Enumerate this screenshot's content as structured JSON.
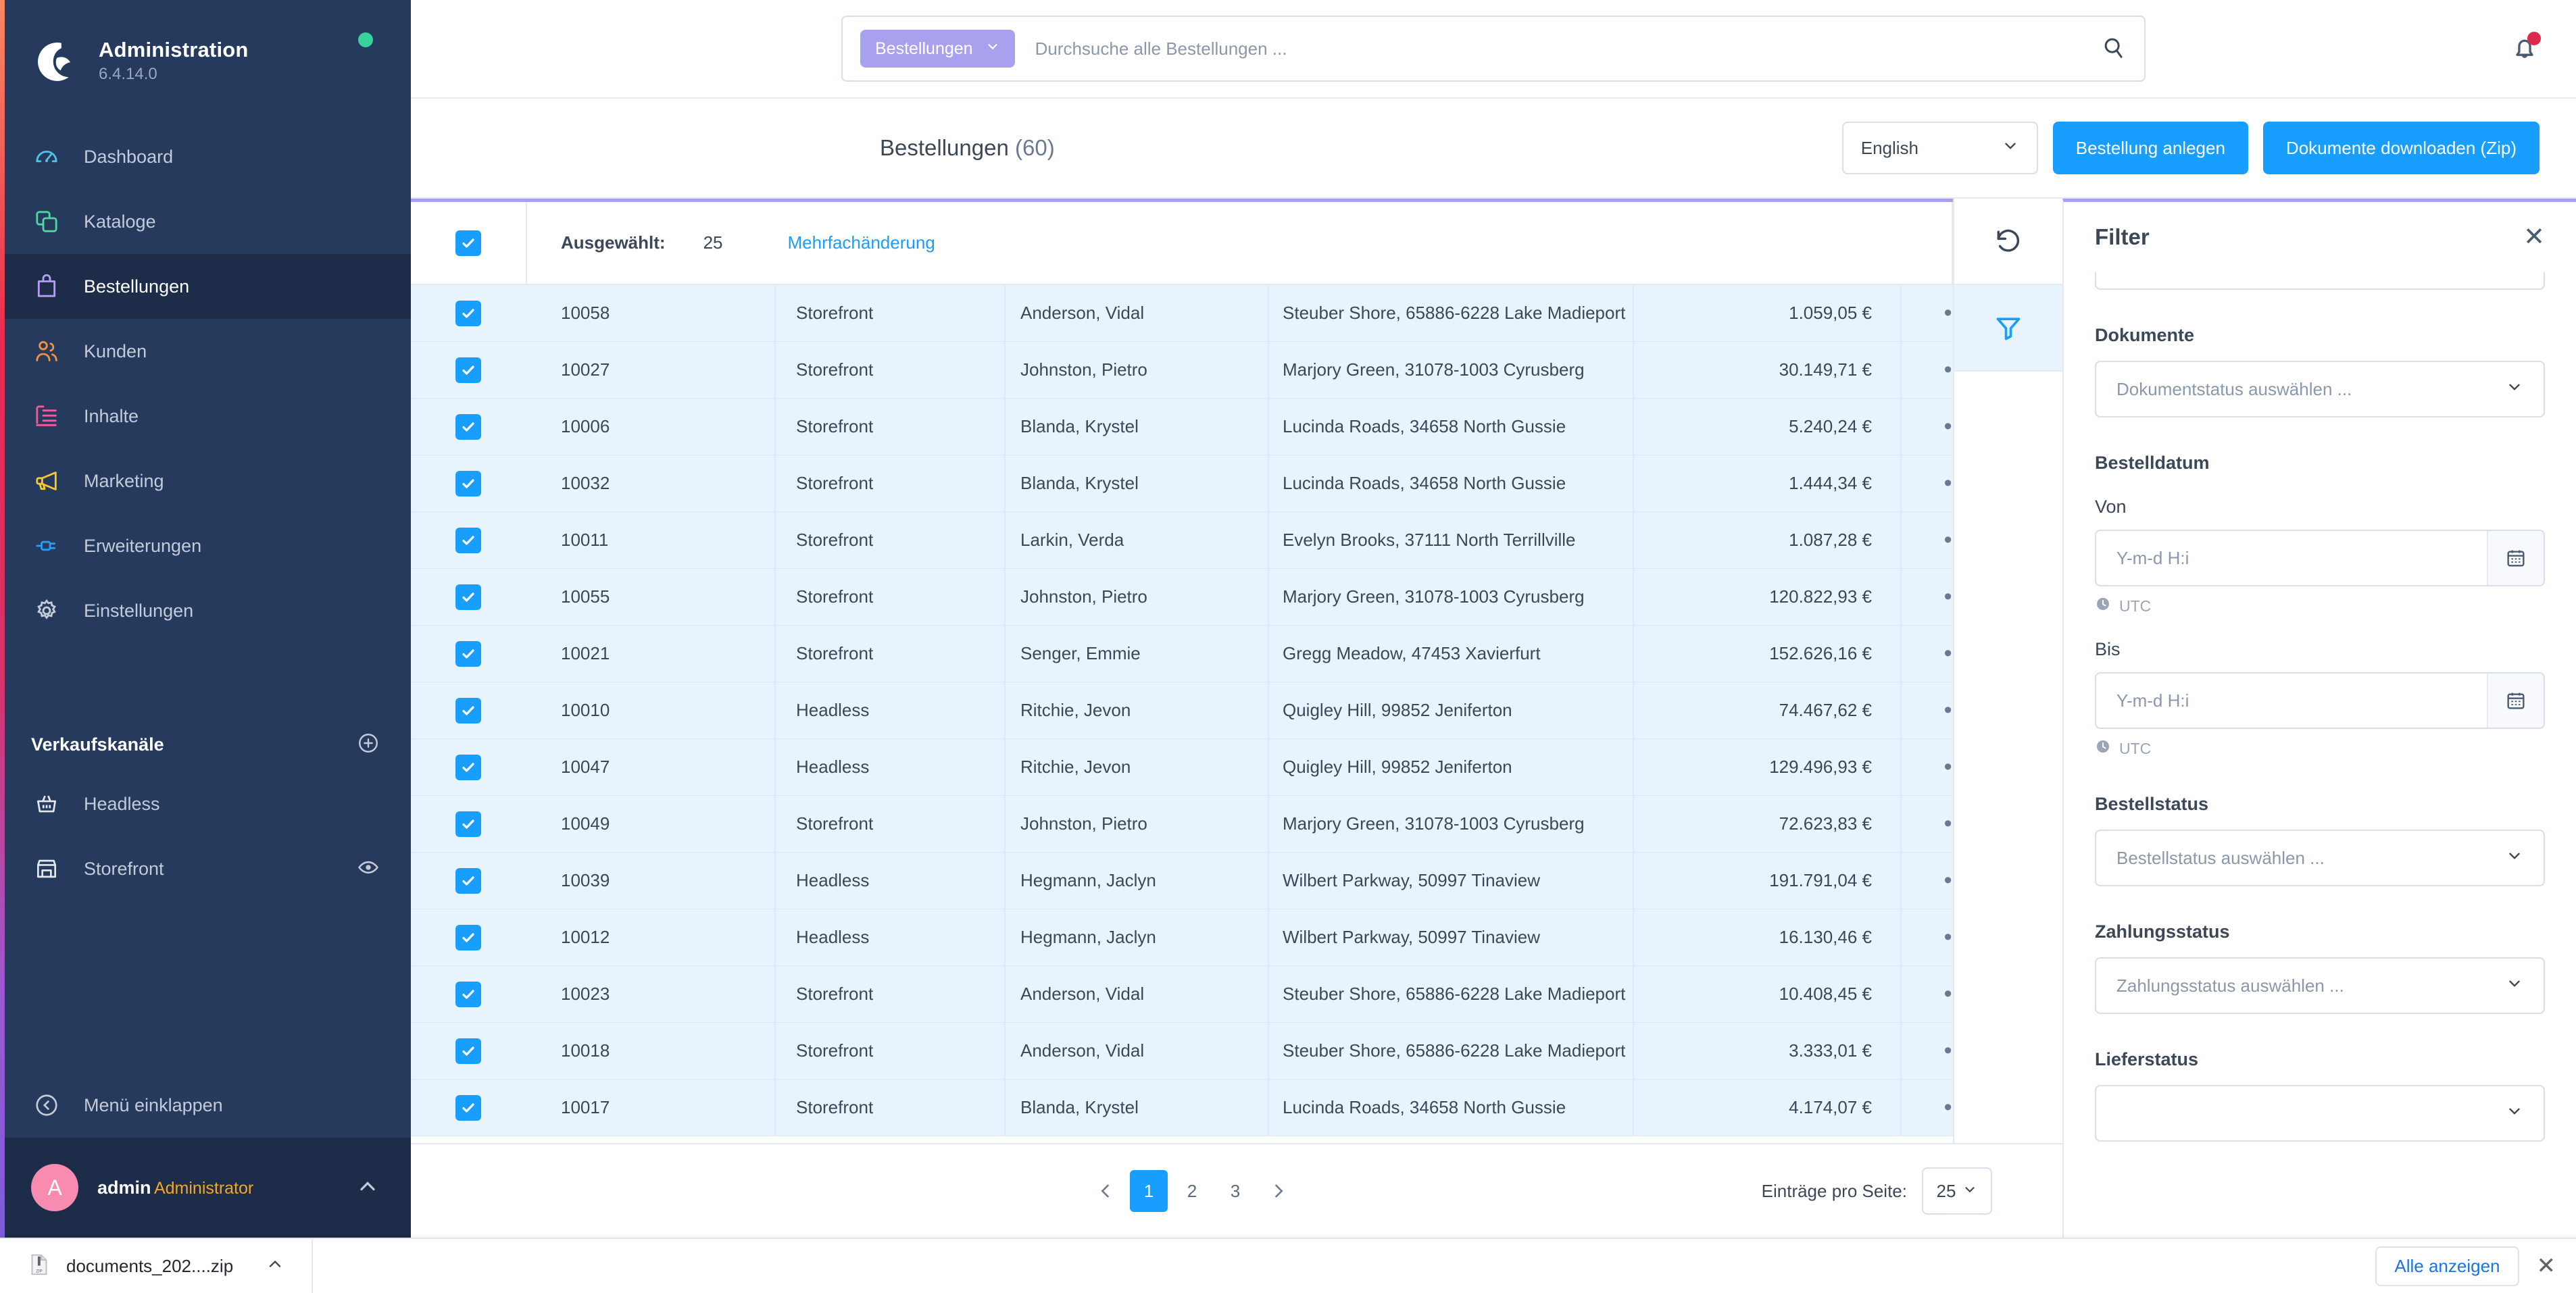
{
  "sidebar": {
    "brand": {
      "title": "Administration",
      "version": "6.4.14.0"
    },
    "items": [
      {
        "label": "Dashboard",
        "icon": "dashboard-icon",
        "color": "#4ec3e8",
        "active": false
      },
      {
        "label": "Kataloge",
        "icon": "catalog-icon",
        "color": "#4ed8a0",
        "active": false
      },
      {
        "label": "Bestellungen",
        "icon": "bag-icon",
        "color": "#b79cf5",
        "active": true
      },
      {
        "label": "Kunden",
        "icon": "users-icon",
        "color": "#f7913c",
        "active": false
      },
      {
        "label": "Inhalte",
        "icon": "content-icon",
        "color": "#f45b9b",
        "active": false
      },
      {
        "label": "Marketing",
        "icon": "megaphone-icon",
        "color": "#f7c72e",
        "active": false
      },
      {
        "label": "Erweiterungen",
        "icon": "plug-icon",
        "color": "#2b9bf4",
        "active": false
      },
      {
        "label": "Einstellungen",
        "icon": "gear-icon",
        "color": "#c3cbd9",
        "active": false
      }
    ],
    "sales_channels": {
      "title": "Verkaufskanäle",
      "items": [
        {
          "label": "Headless",
          "icon": "basket-icon",
          "has_eye": false
        },
        {
          "label": "Storefront",
          "icon": "shop-icon",
          "has_eye": true
        }
      ]
    },
    "collapse_label": "Menü einklappen",
    "user": {
      "initial": "A",
      "name": "admin",
      "role": "Administrator"
    }
  },
  "topbar": {
    "search_scope": "Bestellungen",
    "search_placeholder": "Durchsuche alle Bestellungen ...",
    "search_value": ""
  },
  "header": {
    "title": "Bestellungen",
    "count": "(60)",
    "language": "English",
    "create_order_label": "Bestellung anlegen",
    "download_docs_label": "Dokumente downloaden (Zip)"
  },
  "selection_toolbar": {
    "selected_label": "Ausgewählt:",
    "selected_count": "25",
    "bulk_edit_label": "Mehrfachänderung"
  },
  "table": {
    "rows": [
      {
        "number": "10058",
        "channel": "Storefront",
        "customer": "Anderson, Vidal",
        "address": "Steuber Shore, 65886-6228 Lake Madieport",
        "amount": "1.059,05 €"
      },
      {
        "number": "10027",
        "channel": "Storefront",
        "customer": "Johnston, Pietro",
        "address": "Marjory Green, 31078-1003 Cyrusberg",
        "amount": "30.149,71 €"
      },
      {
        "number": "10006",
        "channel": "Storefront",
        "customer": "Blanda, Krystel",
        "address": "Lucinda Roads, 34658 North Gussie",
        "amount": "5.240,24 €"
      },
      {
        "number": "10032",
        "channel": "Storefront",
        "customer": "Blanda, Krystel",
        "address": "Lucinda Roads, 34658 North Gussie",
        "amount": "1.444,34 €"
      },
      {
        "number": "10011",
        "channel": "Storefront",
        "customer": "Larkin, Verda",
        "address": "Evelyn Brooks, 37111 North Terrillville",
        "amount": "1.087,28 €"
      },
      {
        "number": "10055",
        "channel": "Storefront",
        "customer": "Johnston, Pietro",
        "address": "Marjory Green, 31078-1003 Cyrusberg",
        "amount": "120.822,93 €"
      },
      {
        "number": "10021",
        "channel": "Storefront",
        "customer": "Senger, Emmie",
        "address": "Gregg Meadow, 47453 Xavierfurt",
        "amount": "152.626,16 €"
      },
      {
        "number": "10010",
        "channel": "Headless",
        "customer": "Ritchie, Jevon",
        "address": "Quigley Hill, 99852 Jeniferton",
        "amount": "74.467,62 €"
      },
      {
        "number": "10047",
        "channel": "Headless",
        "customer": "Ritchie, Jevon",
        "address": "Quigley Hill, 99852 Jeniferton",
        "amount": "129.496,93 €"
      },
      {
        "number": "10049",
        "channel": "Storefront",
        "customer": "Johnston, Pietro",
        "address": "Marjory Green, 31078-1003 Cyrusberg",
        "amount": "72.623,83 €"
      },
      {
        "number": "10039",
        "channel": "Headless",
        "customer": "Hegmann, Jaclyn",
        "address": "Wilbert Parkway, 50997 Tinaview",
        "amount": "191.791,04 €"
      },
      {
        "number": "10012",
        "channel": "Headless",
        "customer": "Hegmann, Jaclyn",
        "address": "Wilbert Parkway, 50997 Tinaview",
        "amount": "16.130,46 €"
      },
      {
        "number": "10023",
        "channel": "Storefront",
        "customer": "Anderson, Vidal",
        "address": "Steuber Shore, 65886-6228 Lake Madieport",
        "amount": "10.408,45 €"
      },
      {
        "number": "10018",
        "channel": "Storefront",
        "customer": "Anderson, Vidal",
        "address": "Steuber Shore, 65886-6228 Lake Madieport",
        "amount": "3.333,01 €"
      },
      {
        "number": "10017",
        "channel": "Storefront",
        "customer": "Blanda, Krystel",
        "address": "Lucinda Roads, 34658 North Gussie",
        "amount": "4.174,07 €"
      }
    ],
    "row_action_glyph": "•••"
  },
  "pagination": {
    "pages": [
      "1",
      "2",
      "3"
    ],
    "current": "1",
    "per_page_label": "Einträge pro Seite:",
    "per_page_value": "25"
  },
  "filter_panel": {
    "title": "Filter",
    "groups": [
      {
        "label": "Dokumente",
        "type": "select",
        "placeholder": "Dokumentstatus auswählen ..."
      },
      {
        "label": "Bestelldatum",
        "type": "daterange",
        "from_label": "Von",
        "to_label": "Bis",
        "date_placeholder": "Y-m-d H:i",
        "tz_label": "UTC"
      },
      {
        "label": "Bestellstatus",
        "type": "select",
        "placeholder": "Bestellstatus auswählen ..."
      },
      {
        "label": "Zahlungsstatus",
        "type": "select",
        "placeholder": "Zahlungsstatus auswählen ..."
      },
      {
        "label": "Lieferstatus",
        "type": "select",
        "placeholder": ""
      }
    ]
  },
  "download_bar": {
    "file_name": "documents_202....zip",
    "show_all_label": "Alle anzeigen"
  },
  "colors": {
    "accent_blue": "#189eff",
    "sidebar_bg": "#263a5d",
    "purple_bar": "#a8a2ee",
    "row_selected_bg": "#e7f3fd"
  }
}
